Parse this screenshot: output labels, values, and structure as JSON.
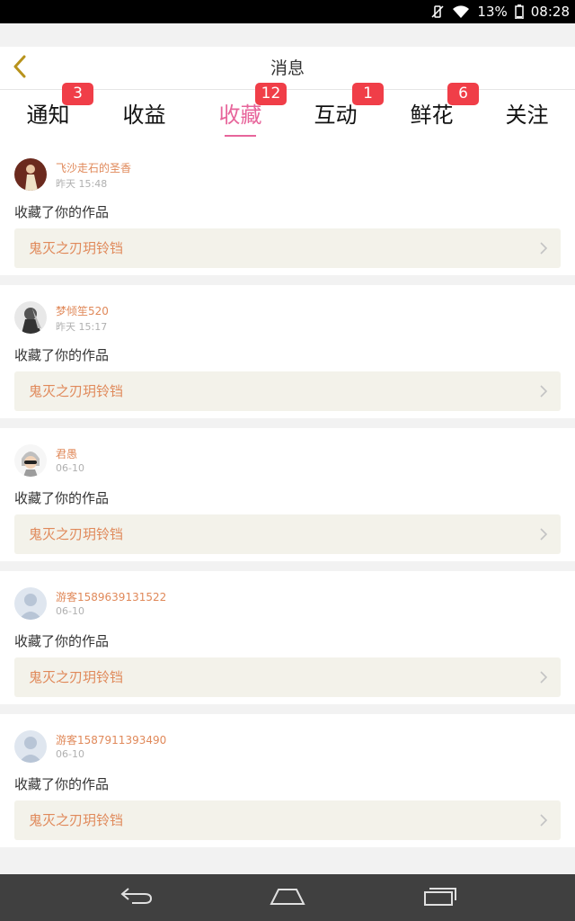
{
  "status_bar": {
    "battery_percent": "13%",
    "time": "08:28",
    "icons": [
      "vibrate-off-icon",
      "wifi-icon",
      "battery-icon"
    ]
  },
  "header": {
    "back_icon": "chevron-left-icon",
    "title": "消息"
  },
  "tabs": [
    {
      "label": "通知",
      "badge": "3"
    },
    {
      "label": "收益",
      "badge": ""
    },
    {
      "label": "收藏",
      "badge": "12",
      "active": true
    },
    {
      "label": "互动",
      "badge": "1"
    },
    {
      "label": "鲜花",
      "badge": "6"
    },
    {
      "label": "关注",
      "badge": ""
    }
  ],
  "colors": {
    "accent": "#e7659b",
    "badge": "#f03e48",
    "username": "#e0895a",
    "link_bg": "#f3f2ea"
  },
  "items": [
    {
      "username": "飞沙走石的圣香",
      "time": "昨天 15:48",
      "action": "收藏了你的作品",
      "work_title": "鬼灭之刃玥铃铛"
    },
    {
      "username": "梦倾笙520",
      "time": "昨天 15:17",
      "action": "收藏了你的作品",
      "work_title": "鬼灭之刃玥铃铛"
    },
    {
      "username": "君愚",
      "time": "06-10",
      "action": "收藏了你的作品",
      "work_title": "鬼灭之刃玥铃铛"
    },
    {
      "username": "游客1589639131522",
      "time": "06-10",
      "action": "收藏了你的作品",
      "work_title": "鬼灭之刃玥铃铛"
    },
    {
      "username": "游客1587911393490",
      "time": "06-10",
      "action": "收藏了你的作品",
      "work_title": "鬼灭之刃玥铃铛"
    }
  ],
  "nav_bar": {
    "icons": [
      "back-nav-icon",
      "home-nav-icon",
      "recents-nav-icon"
    ]
  }
}
